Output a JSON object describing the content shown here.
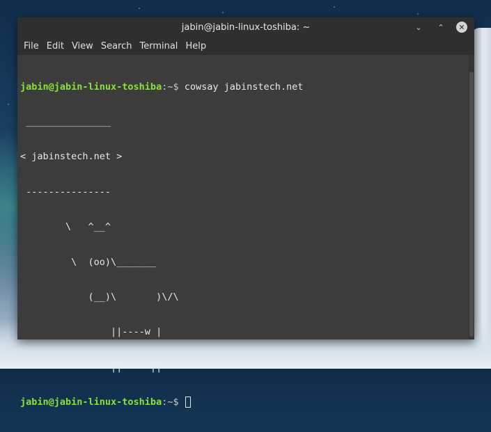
{
  "window": {
    "title": "jabin@jabin-linux-toshiba: ~",
    "minimize_symbol": "⌄",
    "maximize_symbol": "⌃",
    "close_symbol": "✕"
  },
  "menubar": {
    "items": [
      "File",
      "Edit",
      "View",
      "Search",
      "Terminal",
      "Help"
    ]
  },
  "terminal": {
    "prompt_user": "jabin@jabin-linux-toshiba",
    "prompt_suffix": ":~$ ",
    "command": "cowsay jabinstech.net",
    "output_lines": [
      " _______________",
      "< jabinstech.net >",
      " ---------------",
      "        \\   ^__^",
      "         \\  (oo)\\_______",
      "            (__)\\       )\\/\\",
      "                ||----w |",
      "                ||     ||"
    ],
    "second_prompt_user": "jabin@jabin-linux-toshiba",
    "second_prompt_suffix": ":~$ "
  },
  "colors": {
    "prompt_user": "#8ae234",
    "terminal_bg": "#3c3c3c",
    "titlebar_bg": "#2f2f2f"
  }
}
